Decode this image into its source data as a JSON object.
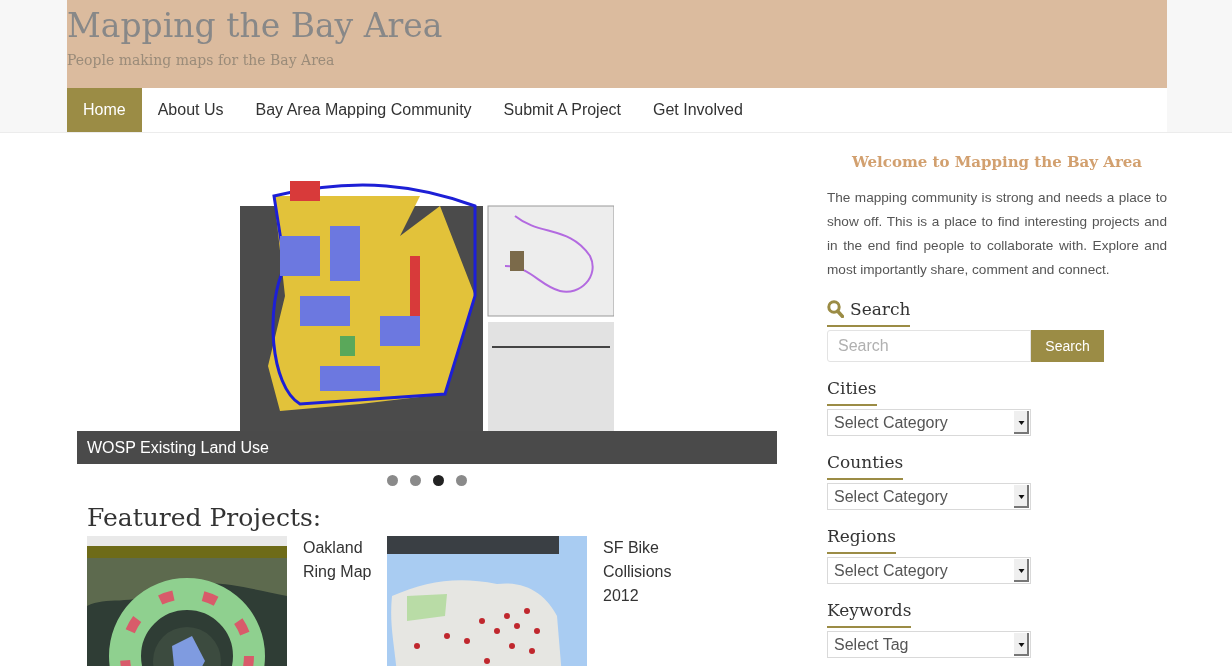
{
  "header": {
    "title": "Mapping the Bay Area",
    "tagline": "People making maps for the Bay Area"
  },
  "nav": [
    {
      "label": "Home",
      "selected": true
    },
    {
      "label": "About Us",
      "selected": false
    },
    {
      "label": "Bay Area Mapping Community",
      "selected": false
    },
    {
      "label": "Submit A Project",
      "selected": false
    },
    {
      "label": "Get Involved",
      "selected": false
    }
  ],
  "slider": {
    "caption": "WOSP Existing Land Use",
    "dots": [
      {
        "selected": false
      },
      {
        "selected": false
      },
      {
        "selected": true
      },
      {
        "selected": false
      }
    ]
  },
  "featured": {
    "heading": "Featured Projects:",
    "projects": [
      {
        "title": "Oakland Ring Map",
        "kind": "ring"
      },
      {
        "title": "SF Bike Collisions 2012",
        "kind": "points"
      }
    ]
  },
  "sidebar": {
    "welcome": {
      "title": "Welcome to Mapping the Bay Area",
      "text": "The mapping community is strong and needs a place to show off. This is a place to find interesting projects and in the end find people to collaborate with. Explore and most importantly share, comment and connect."
    },
    "search": {
      "heading": "Search",
      "placeholder": "Search",
      "button": "Search"
    },
    "filters": [
      {
        "heading": "Cities",
        "value": "Select Category"
      },
      {
        "heading": "Counties",
        "value": "Select Category"
      },
      {
        "heading": "Regions",
        "value": "Select Category"
      },
      {
        "heading": "Keywords",
        "value": "Select Tag"
      }
    ]
  }
}
